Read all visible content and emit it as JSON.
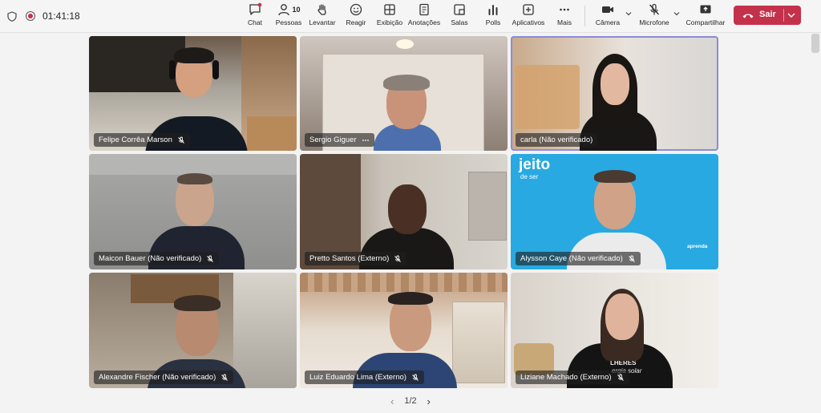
{
  "meeting": {
    "timer": "01:41:18"
  },
  "toolbar": {
    "chat": "Chat",
    "people": "Pessoas",
    "people_count": "10",
    "raise": "Levantar",
    "react": "Reagir",
    "view": "Exibição",
    "notes": "Anotações",
    "rooms": "Salas",
    "polls": "Polls",
    "apps": "Aplicativos",
    "more": "Mais",
    "camera": "Câmera",
    "mic": "Microfone",
    "share": "Compartilhar",
    "leave": "Sair"
  },
  "participants": [
    {
      "name": "Felipe Corrêa Marson",
      "icon": "mic-off-icon"
    },
    {
      "name": "Sergio Giguer",
      "icon": "more-icon"
    },
    {
      "name": "carla (Não verificado)",
      "icon": ""
    },
    {
      "name": "Maicon Bauer (Não verificado)",
      "icon": "mic-off-icon"
    },
    {
      "name": "Pretto Santos (Externo)",
      "icon": "mic-off-icon"
    },
    {
      "name": "Alysson Caye (Não verificado)",
      "icon": "mic-off-icon"
    },
    {
      "name": "Alexandre Fischer (Não verificado)",
      "icon": "mic-off-icon"
    },
    {
      "name": "Luiz Eduardo Lima (Externo)",
      "icon": "mic-off-icon"
    },
    {
      "name": "Liziane Machado (Externo)",
      "icon": "mic-off-icon"
    }
  ],
  "background_text": {
    "brand_top": "jeito",
    "brand_bottom": "de ser",
    "tagline": "aprenda",
    "shirt_1": "LHERES",
    "shirt_2": "ergia solar"
  },
  "pagination": {
    "page": "1/2"
  },
  "colors": {
    "accent": "#c4314b",
    "active_border": "#8d8ad7",
    "tile_blue": "#29a9e1"
  }
}
